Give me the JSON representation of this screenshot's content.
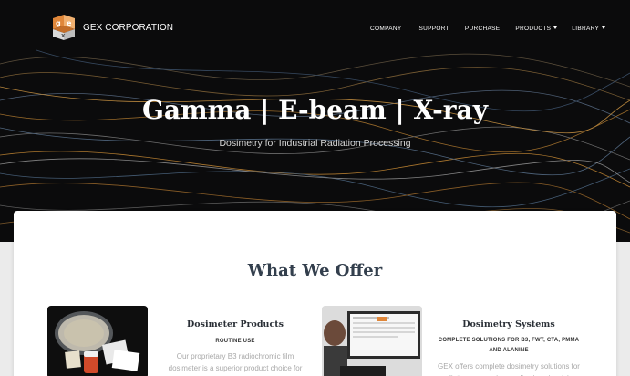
{
  "brand": {
    "name": "GEX CORPORATION",
    "logo_letters": [
      "g",
      "e",
      "x"
    ]
  },
  "nav": {
    "items": [
      {
        "label": "COMPANY",
        "dropdown": false
      },
      {
        "label": "SUPPORT",
        "dropdown": false
      },
      {
        "label": "PURCHASE",
        "dropdown": false
      },
      {
        "label": "PRODUCTS",
        "dropdown": true
      },
      {
        "label": "LIBRARY",
        "dropdown": true
      }
    ]
  },
  "hero": {
    "title": "Gamma | E-beam | X-ray",
    "subtitle": "Dosimetry for Industrial Radiation Processing"
  },
  "offer": {
    "title": "What We Offer",
    "products": [
      {
        "title": "Dosimeter Products",
        "kicker": "ROUTINE USE",
        "description": "Our proprietary B3 radiochromic film dosimeter is a superior product choice for most"
      },
      {
        "title": "Dosimetry Systems",
        "kicker": "COMPLETE SOLUTIONS FOR B3, FWT, CTA, PMMA AND ALANINE",
        "description": "GEX offers complete dosimetry solutions for radiation processing applications involving"
      }
    ]
  },
  "colors": {
    "hero_bg": "#0b0b0c",
    "logo_orange": "#e0873a",
    "title_dark": "#333f4d",
    "muted_text": "#a9a9a9"
  }
}
